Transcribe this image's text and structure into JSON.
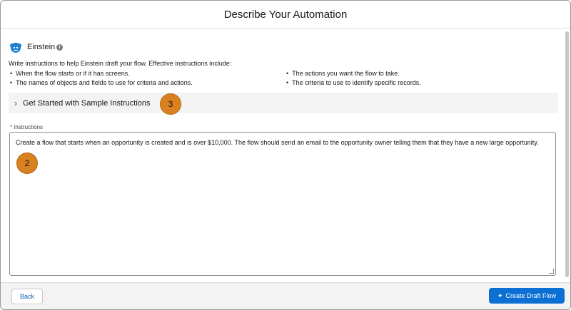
{
  "header": {
    "title": "Describe Your Automation"
  },
  "einstein": {
    "title": "Einstein",
    "info_glyph": "i",
    "intro": "Write instructions to help Einstein draft your flow. Effective instructions include:",
    "tips": [
      "When the flow starts or if it has screens.",
      "The names of objects and fields to use for criteria and actions.",
      "The actions you want the flow to take.",
      "The criteria to use to identify specific records."
    ]
  },
  "accordion": {
    "chevron": "›",
    "label": "Get Started with Sample Instructions"
  },
  "badges": {
    "sample": "3",
    "instructions": "2"
  },
  "instructions": {
    "required_marker": "*",
    "label": "Instructions",
    "value": "Create a flow that starts when an opportunity is created and is over $10,000. The flow should send an email to the opportunity owner telling them that they have a new large opportunity."
  },
  "footer": {
    "back_label": "Back",
    "create_label": "Create Draft Flow",
    "create_icon": "✦"
  },
  "colors": {
    "brand": "#0b6fd4",
    "badge": "#d9811f",
    "required": "#c23934"
  },
  "icons": [
    "einstein-icon",
    "info-icon",
    "chevron-right-icon",
    "sparkle-icon",
    "resize-grip-icon"
  ]
}
